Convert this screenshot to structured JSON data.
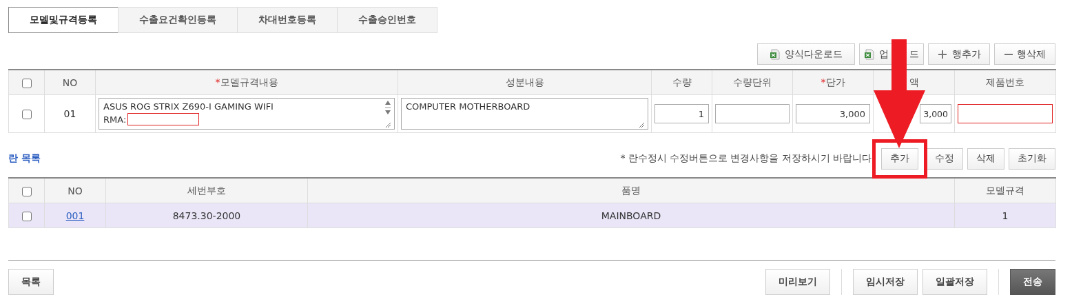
{
  "tabs": [
    {
      "label": "모델및규격등록",
      "selected": true
    },
    {
      "label": "수출요건확인등록",
      "selected": false
    },
    {
      "label": "차대번호등록",
      "selected": false
    },
    {
      "label": "수출승인번호",
      "selected": false
    }
  ],
  "toolbar": [
    {
      "label": "양식다운로드",
      "kind": "excel"
    },
    {
      "label": "업",
      "label_end": "드",
      "kind": "excel"
    },
    {
      "label": "행추가",
      "kind": "plus"
    },
    {
      "label": "행삭제",
      "kind": "minus"
    }
  ],
  "model_table": {
    "header_checked": false,
    "columns": [
      {
        "label": "NO"
      },
      {
        "required_mark": "*",
        "label": "모델규격내용"
      },
      {
        "label": "성분내용"
      },
      {
        "label": "수량"
      },
      {
        "label": "수량단위"
      },
      {
        "required_mark": "*",
        "label": "단가"
      },
      {
        "label": "액"
      },
      {
        "label": "제품번호"
      }
    ],
    "rows": [
      {
        "checked": false,
        "no": "01",
        "model_spec": "ASUS ROG STRIX Z690-I GAMING WIFI",
        "rma_label": "RMA:",
        "rma_invalid": true,
        "component": "COMPUTER MOTHERBOARD",
        "quantity": "1",
        "unit": "",
        "unit_price": "3,000",
        "amount": "3,000",
        "product_no_invalid": true
      }
    ]
  },
  "item_section": {
    "title": "란 목록",
    "notice": "* 란수정시 수정버튼으로 변경사항을 저장하시기 바랍니다",
    "buttons": [
      {
        "label": "추가",
        "highlighted": true
      },
      {
        "label": "수정",
        "highlighted": false
      },
      {
        "label": "삭제",
        "highlighted": false
      },
      {
        "label": "초기화",
        "highlighted": false
      }
    ],
    "header_checked": false,
    "columns": [
      {
        "label": "NO"
      },
      {
        "label": "세번부호"
      },
      {
        "label": "품명"
      },
      {
        "label": "모델규격"
      }
    ],
    "rows": [
      {
        "checked": false,
        "selected": true,
        "no": "001",
        "hs_code": "8473.30-2000",
        "name": "MAINBOARD",
        "model": "1"
      }
    ]
  },
  "footer": {
    "left_buttons": [
      {
        "label": "목록",
        "kind": "default"
      }
    ],
    "right_groups": [
      [
        {
          "label": "미리보기",
          "kind": "default"
        }
      ],
      [
        {
          "label": "임시저장",
          "kind": "default"
        },
        {
          "label": "일괄저장",
          "kind": "default"
        }
      ],
      [
        {
          "label": "전송",
          "kind": "primary"
        }
      ]
    ]
  }
}
